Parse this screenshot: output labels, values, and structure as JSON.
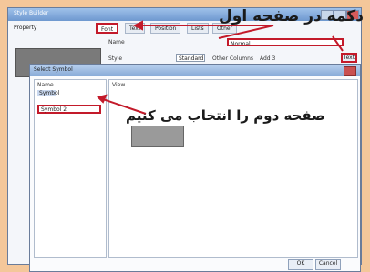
{
  "window": {
    "title": "Style Builder"
  },
  "tabs": {
    "property_label": "Property",
    "items": [
      "Font",
      "Text",
      "Position",
      "Lists",
      "Other"
    ],
    "active_index": 0
  },
  "general": {
    "name_label": "Name",
    "style_label": "Style",
    "style_select": "Standard",
    "other_label": "Other Columns",
    "other_value": "Add 3",
    "input_value": "Normal",
    "browse_label": "Text"
  },
  "dialog": {
    "title": "Select Symbol",
    "list_header": "Name",
    "preview_header": "View",
    "items": [
      "Symbol",
      "Symbol 2"
    ],
    "ok_label": "OK",
    "cancel_label": "Cancel"
  },
  "annotations": {
    "first": "دکمه در صفحه اول",
    "second": "صفحه دوم را انتخاب می کنیم"
  },
  "colors": {
    "highlight": "#c31a2a",
    "page_bg": "#f4c79a"
  }
}
